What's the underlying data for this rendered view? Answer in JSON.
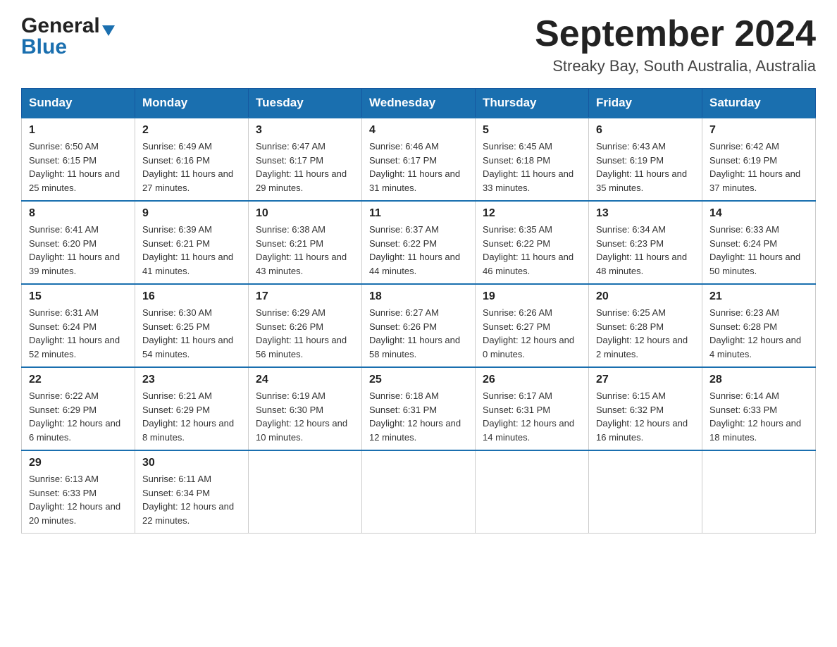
{
  "header": {
    "logo_general": "General",
    "logo_blue": "Blue",
    "month_title": "September 2024",
    "location": "Streaky Bay, South Australia, Australia"
  },
  "weekdays": [
    "Sunday",
    "Monday",
    "Tuesday",
    "Wednesday",
    "Thursday",
    "Friday",
    "Saturday"
  ],
  "weeks": [
    [
      {
        "day": "1",
        "sunrise": "6:50 AM",
        "sunset": "6:15 PM",
        "daylight": "11 hours and 25 minutes."
      },
      {
        "day": "2",
        "sunrise": "6:49 AM",
        "sunset": "6:16 PM",
        "daylight": "11 hours and 27 minutes."
      },
      {
        "day": "3",
        "sunrise": "6:47 AM",
        "sunset": "6:17 PM",
        "daylight": "11 hours and 29 minutes."
      },
      {
        "day": "4",
        "sunrise": "6:46 AM",
        "sunset": "6:17 PM",
        "daylight": "11 hours and 31 minutes."
      },
      {
        "day": "5",
        "sunrise": "6:45 AM",
        "sunset": "6:18 PM",
        "daylight": "11 hours and 33 minutes."
      },
      {
        "day": "6",
        "sunrise": "6:43 AM",
        "sunset": "6:19 PM",
        "daylight": "11 hours and 35 minutes."
      },
      {
        "day": "7",
        "sunrise": "6:42 AM",
        "sunset": "6:19 PM",
        "daylight": "11 hours and 37 minutes."
      }
    ],
    [
      {
        "day": "8",
        "sunrise": "6:41 AM",
        "sunset": "6:20 PM",
        "daylight": "11 hours and 39 minutes."
      },
      {
        "day": "9",
        "sunrise": "6:39 AM",
        "sunset": "6:21 PM",
        "daylight": "11 hours and 41 minutes."
      },
      {
        "day": "10",
        "sunrise": "6:38 AM",
        "sunset": "6:21 PM",
        "daylight": "11 hours and 43 minutes."
      },
      {
        "day": "11",
        "sunrise": "6:37 AM",
        "sunset": "6:22 PM",
        "daylight": "11 hours and 44 minutes."
      },
      {
        "day": "12",
        "sunrise": "6:35 AM",
        "sunset": "6:22 PM",
        "daylight": "11 hours and 46 minutes."
      },
      {
        "day": "13",
        "sunrise": "6:34 AM",
        "sunset": "6:23 PM",
        "daylight": "11 hours and 48 minutes."
      },
      {
        "day": "14",
        "sunrise": "6:33 AM",
        "sunset": "6:24 PM",
        "daylight": "11 hours and 50 minutes."
      }
    ],
    [
      {
        "day": "15",
        "sunrise": "6:31 AM",
        "sunset": "6:24 PM",
        "daylight": "11 hours and 52 minutes."
      },
      {
        "day": "16",
        "sunrise": "6:30 AM",
        "sunset": "6:25 PM",
        "daylight": "11 hours and 54 minutes."
      },
      {
        "day": "17",
        "sunrise": "6:29 AM",
        "sunset": "6:26 PM",
        "daylight": "11 hours and 56 minutes."
      },
      {
        "day": "18",
        "sunrise": "6:27 AM",
        "sunset": "6:26 PM",
        "daylight": "11 hours and 58 minutes."
      },
      {
        "day": "19",
        "sunrise": "6:26 AM",
        "sunset": "6:27 PM",
        "daylight": "12 hours and 0 minutes."
      },
      {
        "day": "20",
        "sunrise": "6:25 AM",
        "sunset": "6:28 PM",
        "daylight": "12 hours and 2 minutes."
      },
      {
        "day": "21",
        "sunrise": "6:23 AM",
        "sunset": "6:28 PM",
        "daylight": "12 hours and 4 minutes."
      }
    ],
    [
      {
        "day": "22",
        "sunrise": "6:22 AM",
        "sunset": "6:29 PM",
        "daylight": "12 hours and 6 minutes."
      },
      {
        "day": "23",
        "sunrise": "6:21 AM",
        "sunset": "6:29 PM",
        "daylight": "12 hours and 8 minutes."
      },
      {
        "day": "24",
        "sunrise": "6:19 AM",
        "sunset": "6:30 PM",
        "daylight": "12 hours and 10 minutes."
      },
      {
        "day": "25",
        "sunrise": "6:18 AM",
        "sunset": "6:31 PM",
        "daylight": "12 hours and 12 minutes."
      },
      {
        "day": "26",
        "sunrise": "6:17 AM",
        "sunset": "6:31 PM",
        "daylight": "12 hours and 14 minutes."
      },
      {
        "day": "27",
        "sunrise": "6:15 AM",
        "sunset": "6:32 PM",
        "daylight": "12 hours and 16 minutes."
      },
      {
        "day": "28",
        "sunrise": "6:14 AM",
        "sunset": "6:33 PM",
        "daylight": "12 hours and 18 minutes."
      }
    ],
    [
      {
        "day": "29",
        "sunrise": "6:13 AM",
        "sunset": "6:33 PM",
        "daylight": "12 hours and 20 minutes."
      },
      {
        "day": "30",
        "sunrise": "6:11 AM",
        "sunset": "6:34 PM",
        "daylight": "12 hours and 22 minutes."
      },
      null,
      null,
      null,
      null,
      null
    ]
  ]
}
